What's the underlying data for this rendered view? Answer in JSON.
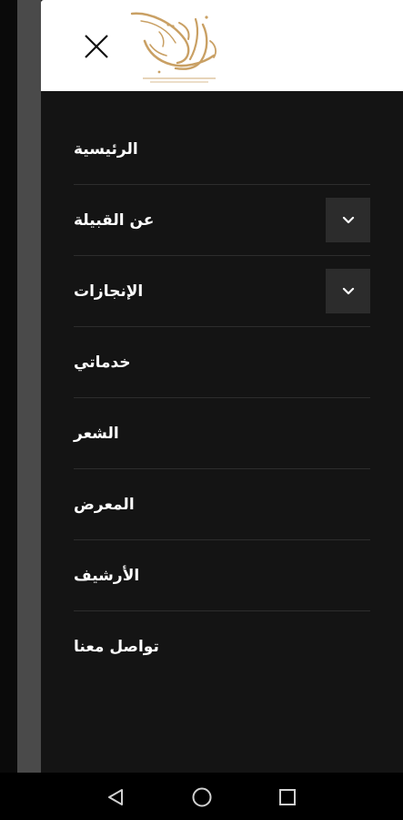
{
  "header": {
    "logo_alt": "موقع القبيلة الرسمي"
  },
  "menu": {
    "items": [
      {
        "label": "الرئيسية",
        "expandable": false
      },
      {
        "label": "عن القبيلة",
        "expandable": true
      },
      {
        "label": "الإنجازات",
        "expandable": true
      },
      {
        "label": "خدماتي",
        "expandable": false
      },
      {
        "label": "الشعر",
        "expandable": false
      },
      {
        "label": "المعرض",
        "expandable": false
      },
      {
        "label": "الأرشيف",
        "expandable": false
      },
      {
        "label": "تواصل معنا",
        "expandable": false
      }
    ]
  },
  "icons": {
    "close": "close-icon",
    "expand": "chevron-down-icon",
    "back": "nav-back-icon",
    "home": "nav-home-icon",
    "recents": "nav-recents-icon"
  },
  "colors": {
    "drawer_bg": "#141414",
    "header_bg": "#ffffff",
    "logo_gold": "#c9a064",
    "divider": "#2d2d2d",
    "expand_bg": "#2c2c2c",
    "text": "#ffffff"
  }
}
